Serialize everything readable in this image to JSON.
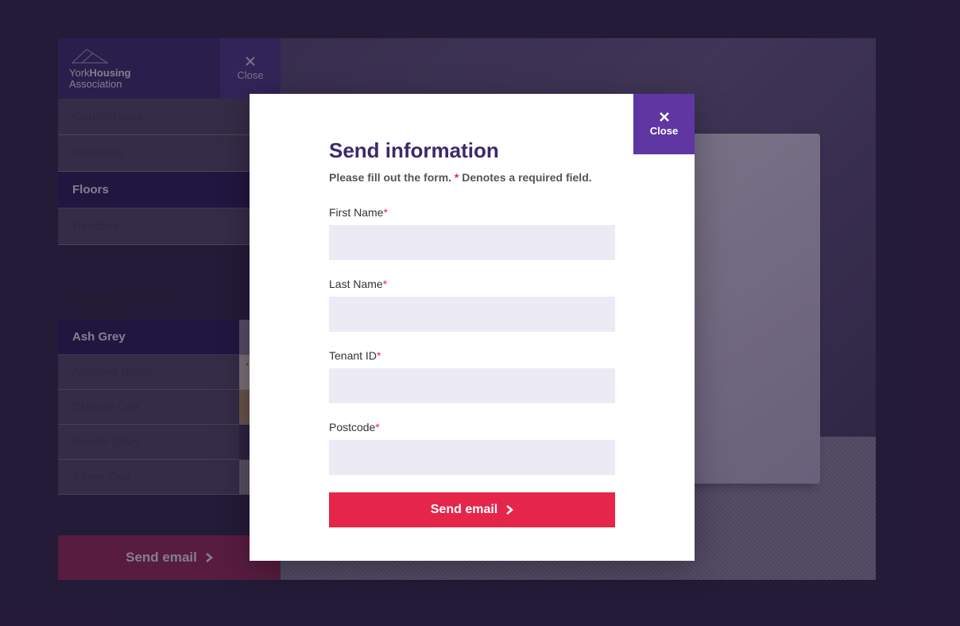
{
  "logo": {
    "line1_light": "York",
    "line1_bold": "Housing",
    "line2_bold": "Association"
  },
  "sidebar": {
    "close_label": "Close",
    "categories": [
      {
        "label": "Countertops",
        "active": false
      },
      {
        "label": "Cabinets",
        "active": false
      },
      {
        "label": "Floors",
        "active": true
      },
      {
        "label": "Handles",
        "active": false
      }
    ],
    "material": {
      "title": "Select material:",
      "selected_prefix": "Selected:",
      "selected_value": "Ash Grey",
      "items": [
        {
          "label": "Ash Grey",
          "swatch": "ashgrey",
          "active": true
        },
        {
          "label": "Autumn Biege",
          "swatch": "autumn",
          "active": false
        },
        {
          "label": "Classic Oak",
          "swatch": "oak",
          "active": false
        },
        {
          "label": "Nordic Grey",
          "swatch": "nordic",
          "active": false
        },
        {
          "label": "Silver Oak",
          "swatch": "silver",
          "active": false
        }
      ]
    },
    "send_email_label": "Send email"
  },
  "modal": {
    "close_label": "Close",
    "title": "Send information",
    "subtitle_pre": "Please fill out the form. ",
    "subtitle_mark": "*",
    "subtitle_post": " Denotes a required field.",
    "fields": {
      "first_name": {
        "label": "First Name",
        "required": "*",
        "value": ""
      },
      "last_name": {
        "label": "Last Name",
        "required": "*",
        "value": ""
      },
      "tenant_id": {
        "label": "Tenant ID",
        "required": "*",
        "value": ""
      },
      "postcode": {
        "label": "Postcode",
        "required": "*",
        "value": ""
      }
    },
    "submit_label": "Send email"
  }
}
